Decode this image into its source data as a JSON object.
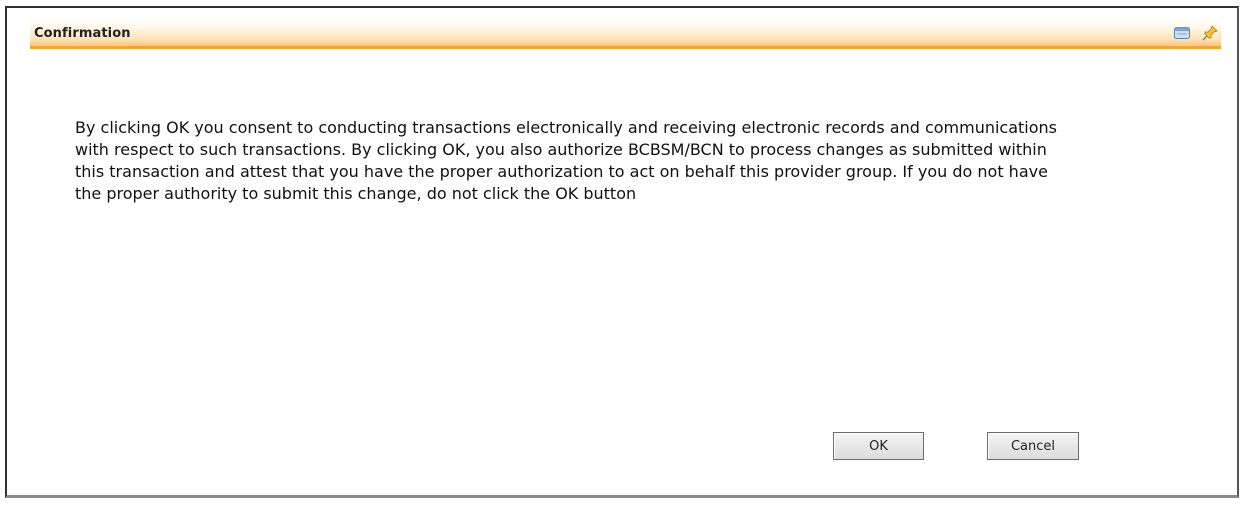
{
  "dialog": {
    "title": "Confirmation",
    "header_icons": [
      "window-icon",
      "pin-icon"
    ],
    "message": "By clicking OK you consent to conducting transactions electronically and receiving electronic records and communications with respect to such transactions. By clicking OK, you also authorize BCBSM/BCN to process changes as submitted within this transaction and attest that you have the proper authorization to act on behalf this provider group. If you do not have the proper authority to submit this change, do not click the OK button",
    "buttons": {
      "ok_label": "OK",
      "cancel_label": "Cancel"
    }
  },
  "colors": {
    "header_accent": "#f3a33a",
    "header_gradient_end": "#f9c47c",
    "border": "#333333"
  }
}
